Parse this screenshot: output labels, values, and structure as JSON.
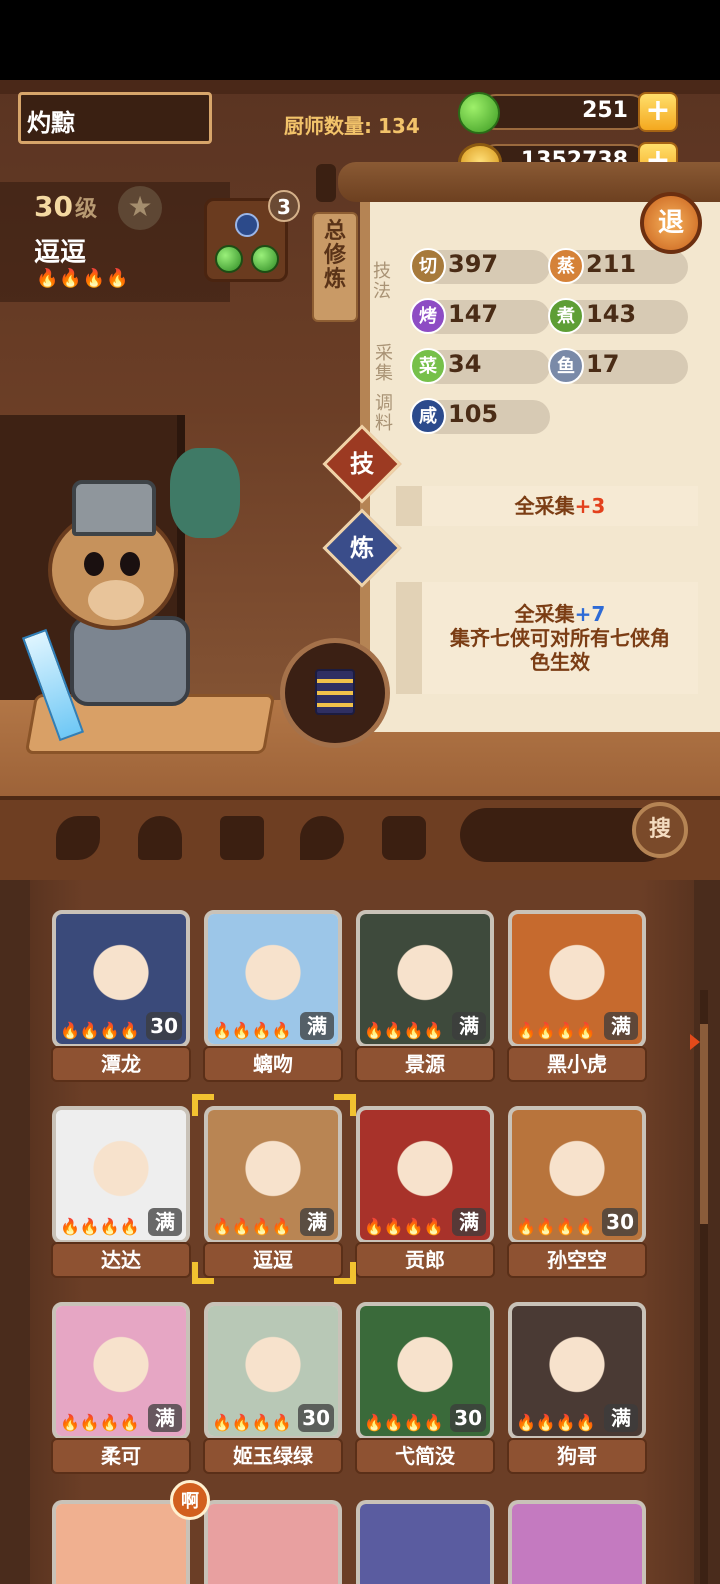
{
  "player": {
    "name": "灼黥"
  },
  "chef_count": {
    "label": "厨师数量:",
    "value": "134"
  },
  "resources": {
    "apples": "251",
    "coins": "1352738",
    "plus": "+"
  },
  "exit_label": "退",
  "selected_chef": {
    "level": "30",
    "level_unit": "级",
    "name": "逗逗",
    "flames": "🔥🔥🔥🔥",
    "equip_count": "3"
  },
  "panel": {
    "tab_label": "总修炼",
    "side_labels": {
      "skill": "技法",
      "gather": "采集",
      "season": "调料"
    },
    "stats": [
      {
        "icon": "切",
        "color": "#a77a3b",
        "value": "397"
      },
      {
        "icon": "蒸",
        "color": "#d58238",
        "value": "211"
      },
      {
        "icon": "烤",
        "color": "#8d4cc4",
        "value": "147"
      },
      {
        "icon": "煮",
        "color": "#5e9e35",
        "value": "143"
      },
      {
        "icon": "菜",
        "color": "#76c04a",
        "value": "34"
      },
      {
        "icon": "鱼",
        "color": "#7a8aa8",
        "value": "17"
      },
      {
        "icon": "咸",
        "color": "#2b4a8c",
        "value": "105"
      }
    ],
    "skill_diamond": "技",
    "refine_diamond": "炼",
    "skill_bar": {
      "text": "全采集",
      "bonus": "+3"
    },
    "refine_box": {
      "title": "全采集",
      "bonus": "+7",
      "line1": "集齐七侠可对所有七侠角",
      "line2": "色生效"
    }
  },
  "search": {
    "label": "搜"
  },
  "chefs": [
    {
      "name": "潭龙",
      "badge": "30",
      "color": "#3a4a7a"
    },
    {
      "name": "螭吻",
      "badge": "满",
      "color": "#9cc6e8"
    },
    {
      "name": "景源",
      "badge": "满",
      "color": "#3e4a3c"
    },
    {
      "name": "黑小虎",
      "badge": "满",
      "color": "#c66a2e"
    },
    {
      "name": "达达",
      "badge": "满",
      "color": "#eeeeee"
    },
    {
      "name": "逗逗",
      "badge": "满",
      "color": "#b98553"
    },
    {
      "name": "贡郎",
      "badge": "满",
      "color": "#a8322a"
    },
    {
      "name": "孙空空",
      "badge": "30",
      "color": "#b8743c"
    },
    {
      "name": "柔可",
      "badge": "满",
      "color": "#e6a6c4"
    },
    {
      "name": "姬玉绿绿",
      "badge": "30",
      "color": "#b8c8b6"
    },
    {
      "name": "弋简没",
      "badge": "30",
      "color": "#3a6a3a"
    },
    {
      "name": "狗哥",
      "badge": "满",
      "color": "#4a3a34"
    }
  ],
  "chef_flames": "🔥🔥🔥🔥",
  "speech_bubble": "啊"
}
